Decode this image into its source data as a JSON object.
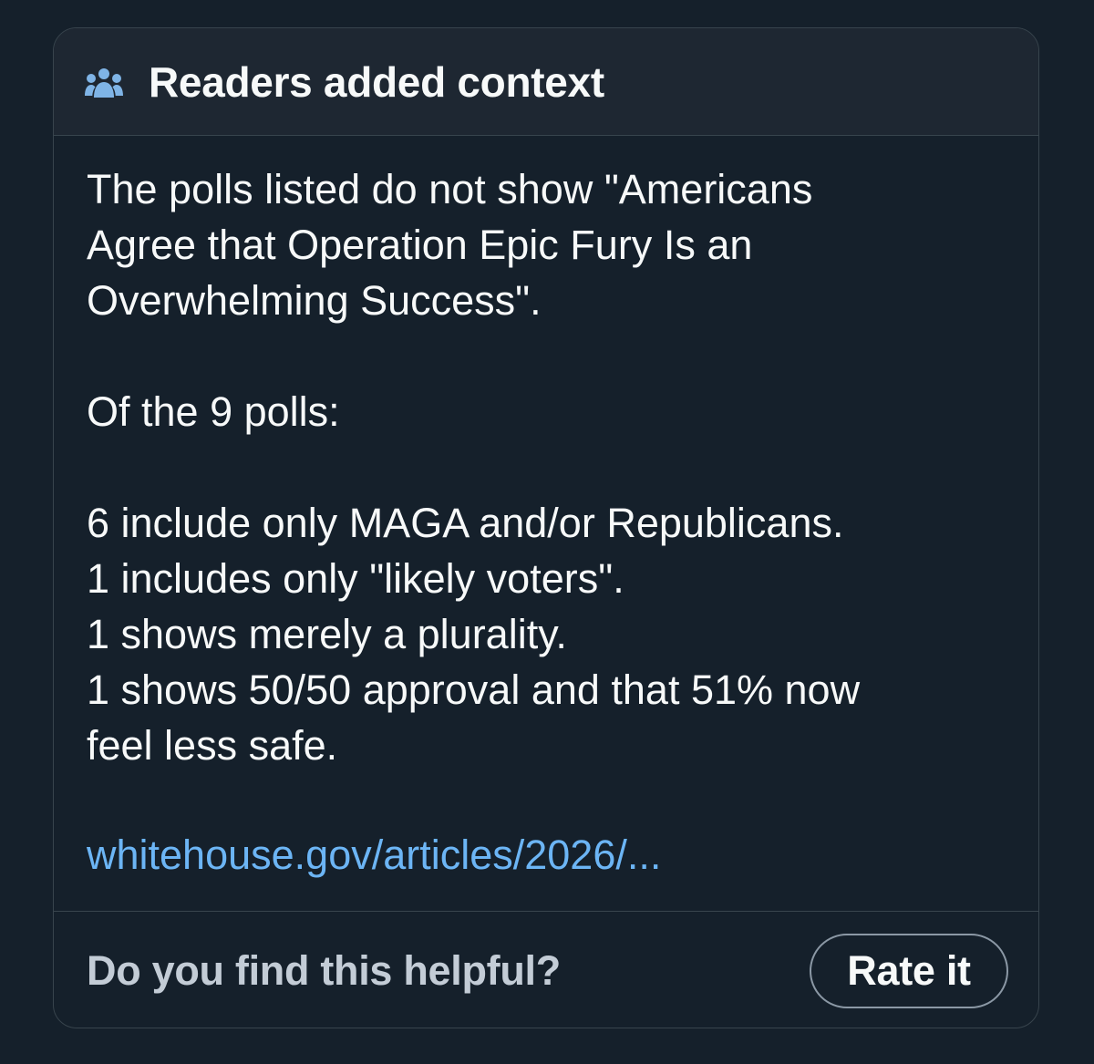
{
  "header": {
    "icon": "people-group-icon",
    "title": "Readers added context"
  },
  "note": {
    "lines": [
      "The polls listed do not show \"Americans",
      "Agree that Operation Epic Fury Is an",
      "Overwhelming Success\".",
      "",
      "Of the 9 polls:",
      "",
      "6 include only MAGA and/or Republicans.",
      "1 includes only \"likely voters\".",
      "1 shows merely a plurality.",
      "1 shows 50/50 approval and that 51% now",
      "feel less safe."
    ],
    "link_text": "whitehouse.gov/articles/2026/..."
  },
  "footer": {
    "question": "Do you find this helpful?",
    "button_label": "Rate it"
  },
  "colors": {
    "background": "#15202b",
    "header_background": "#1e2732",
    "border": "#38444d",
    "text": "#f7f9f9",
    "muted_text": "#c3ccd6",
    "link": "#6cb5f5",
    "icon": "#7fb4e6"
  }
}
